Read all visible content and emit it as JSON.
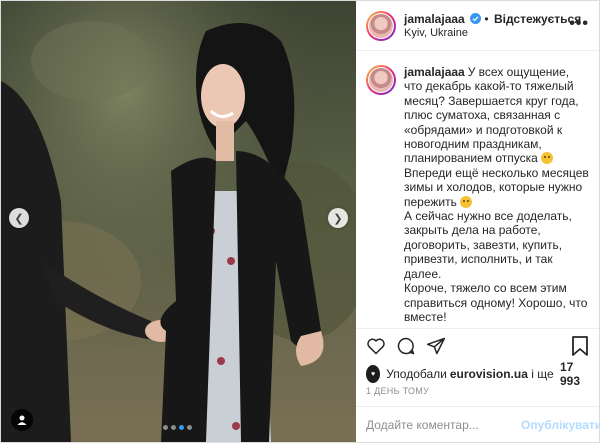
{
  "post": {
    "username": "jamalajaaa",
    "separator": "•",
    "follow_status": "Відстежується",
    "location": "Kyiv, Ukraine",
    "more_icon": "more-horizontal-icon",
    "caption_lines": [
      "У всех ощущение, что декабрь какой-то тяжелый месяц? Завершается круг года, плюс суматоха, связанная с «обрядами» и подготовкой к новогодним праздникам, планированием отпуска ",
      " Впереди ещё несколько месяцев зимы и холодов, которые нужно пережить ",
      "\nА сейчас нужно все доделать, закрыть дела на работе, договорить, завезти, купить, привезти, исполнить, и так далее.\nКороче, тяжело со всем этим справиться одному! Хорошо, что вместе!\n\nЖелаю всем дружно пережить, помочь, подставить плечо, подать"
    ],
    "emojis": [
      "flushed-face-emoji",
      "worried-face-emoji"
    ]
  },
  "carousel": {
    "current_index": 3,
    "total": 4
  },
  "actions": {
    "icons": [
      "heart-icon",
      "comment-icon",
      "share-icon",
      "bookmark-icon"
    ]
  },
  "likes": {
    "avatar_label": "EUROVISION",
    "prefix": "Уподобали ",
    "account": "eurovision.ua",
    "middle": " і ще ",
    "count": "17 993"
  },
  "timestamp": "1 день тому",
  "comment_form": {
    "placeholder": "Додайте коментар...",
    "publish_label": "Опублікувати"
  },
  "colors": {
    "accent": "#3897f0",
    "publish_disabled": "#b3dbff",
    "border": "#dbdbdb",
    "muted_text": "#8e8e8e"
  }
}
